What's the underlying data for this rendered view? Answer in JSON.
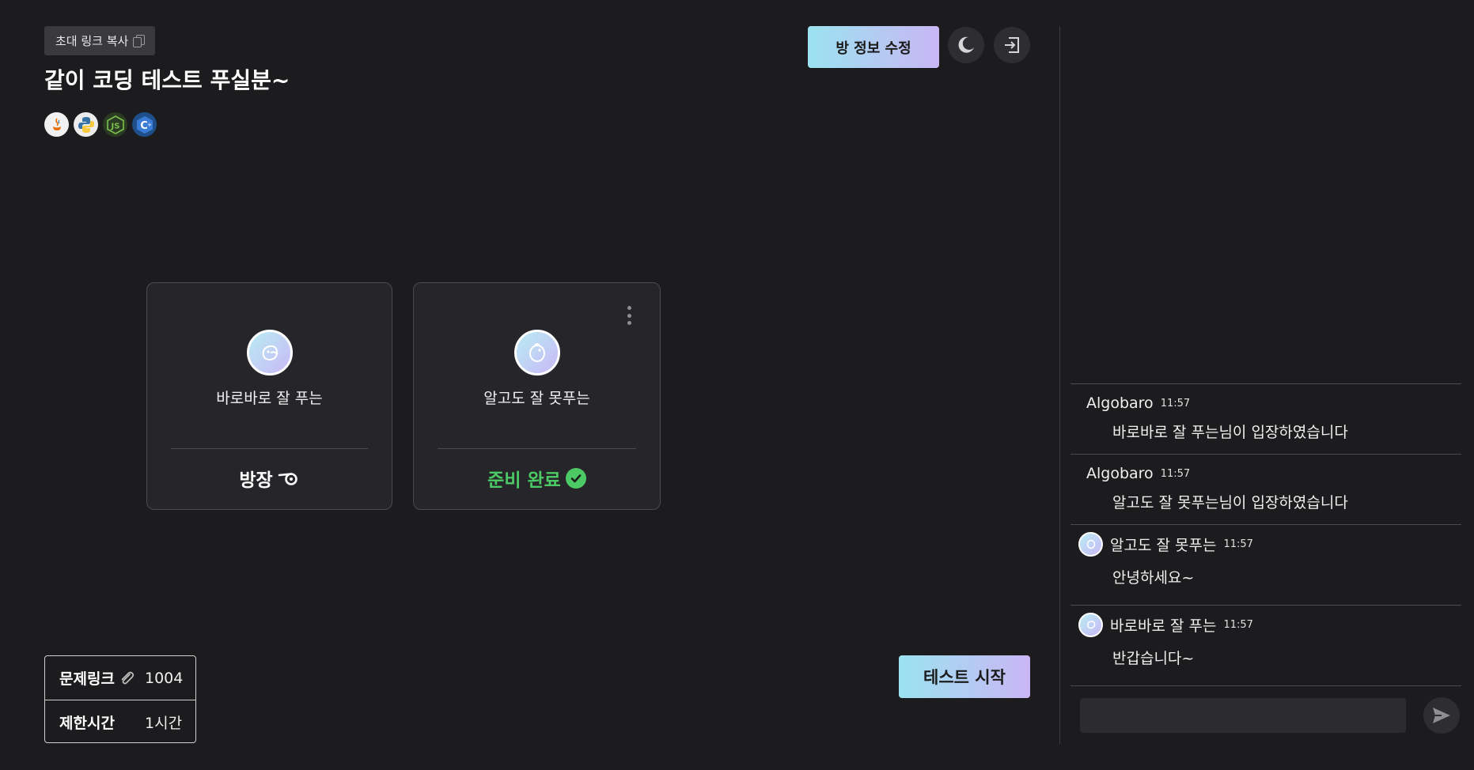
{
  "header": {
    "invite_label": "초대 링크 복사",
    "room_title": "같이 코딩 테스트 푸실분~",
    "edit_label": "방 정보 수정"
  },
  "languages": [
    "java-icon",
    "python-icon",
    "nodejs-icon",
    "cpp-icon"
  ],
  "players": [
    {
      "name": "바로바로 잘 푸는",
      "status": "방장",
      "status_icon": "whistle-icon"
    },
    {
      "name": "알고도 잘 못푸는",
      "status": "준비 완료",
      "status_icon": "check-circle-icon"
    }
  ],
  "info": {
    "problem_label": "문제링크",
    "problem_value": "1004",
    "time_label": "제한시간",
    "time_value": "1시간"
  },
  "start_label": "테스트 시작",
  "chat": {
    "messages": [
      {
        "sender": "Algobaro",
        "time": "11:57",
        "text": "바로바로 잘 푸는님이 입장하였습니다"
      },
      {
        "sender": "Algobaro",
        "time": "11:57",
        "text": "알고도 잘 못푸는님이 입장하였습니다"
      },
      {
        "sender": "알고도 잘 못푸는",
        "time": "11:57",
        "text": "안녕하세요~"
      },
      {
        "sender": "바로바로 잘 푸는",
        "time": "11:57",
        "text": "반갑습니다~"
      }
    ],
    "input_value": ""
  },
  "colors": {
    "background": "#1c1b1d",
    "accent_gradient_start": "#9be3f0",
    "accent_gradient_end": "#c9b6f4",
    "ready": "#4cc964"
  }
}
